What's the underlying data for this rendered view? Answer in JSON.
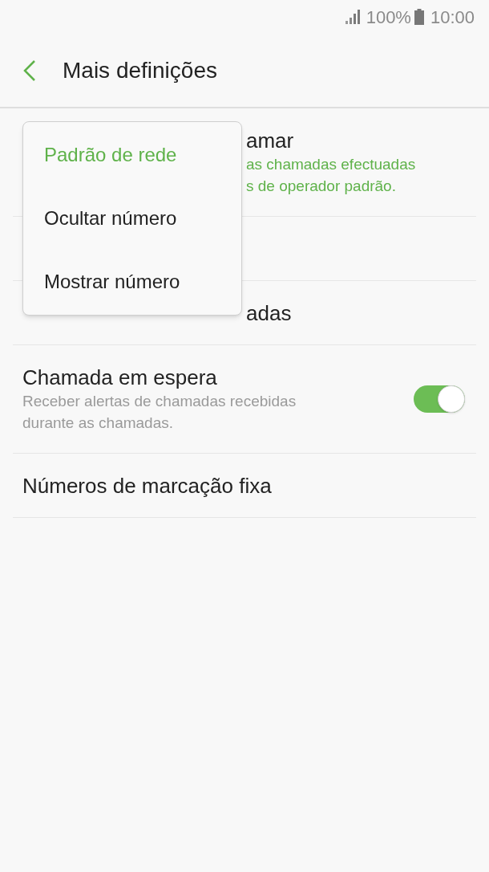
{
  "status_bar": {
    "battery": "100%",
    "time": "10:00"
  },
  "header": {
    "title": "Mais definições"
  },
  "settings": [
    {
      "kind": "text",
      "title": "amar",
      "subtitle_lines": [
        "as chamadas efectuadas",
        "s de operador padrão."
      ],
      "subtitle_accent": true
    },
    {
      "kind": "hidden"
    },
    {
      "kind": "text",
      "title": "adas"
    },
    {
      "kind": "switch",
      "title": "Chamada em espera",
      "subtitle_lines": [
        "Receber alertas de chamadas recebidas",
        "durante as chamadas."
      ],
      "subtitle_accent": false,
      "on": true
    },
    {
      "kind": "text",
      "title": "Números de marcação fixa"
    }
  ],
  "menu": {
    "items": [
      {
        "label": "Padrão de rede",
        "selected": true
      },
      {
        "label": "Ocultar número",
        "selected": false
      },
      {
        "label": "Mostrar número",
        "selected": false
      }
    ]
  }
}
